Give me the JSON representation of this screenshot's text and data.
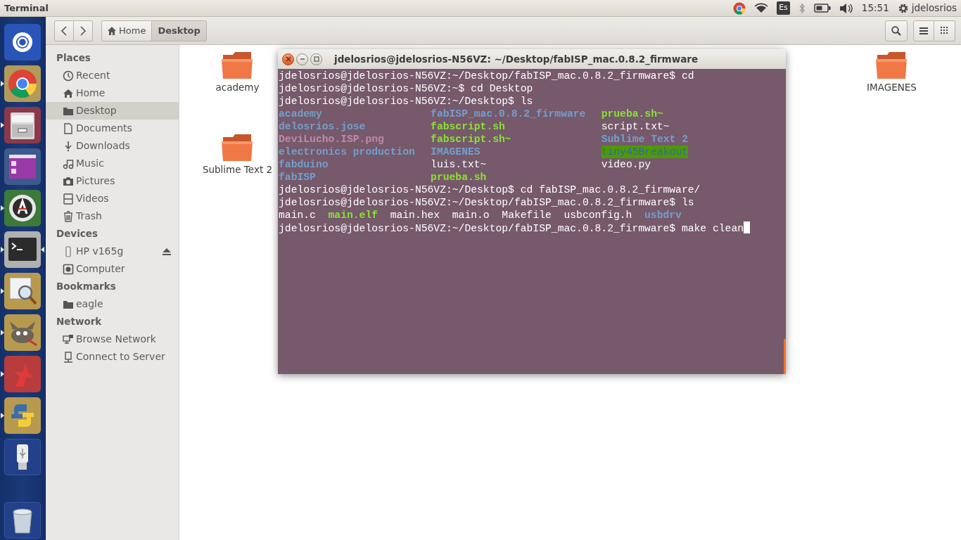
{
  "top_panel": {
    "title": "Terminal",
    "indicators": [
      {
        "kind": "browser"
      },
      {
        "kind": "wifi"
      },
      {
        "kind": "keyboard",
        "text": "Es"
      },
      {
        "kind": "bluetooth"
      },
      {
        "kind": "battery"
      },
      {
        "kind": "volume"
      },
      {
        "kind": "clock",
        "text": "15:51"
      },
      {
        "kind": "session",
        "text": "jdelosrios"
      }
    ]
  },
  "launcher": [
    {
      "kind": "dash",
      "running": false,
      "focused": false
    },
    {
      "kind": "browser",
      "running": true,
      "focused": false
    },
    {
      "kind": "files",
      "running": true,
      "focused": false
    },
    {
      "kind": "workspaces",
      "running": false,
      "focused": false
    },
    {
      "kind": "updater",
      "running": true,
      "focused": false
    },
    {
      "kind": "terminal",
      "running": true,
      "focused": true
    },
    {
      "kind": "viewer",
      "running": true,
      "focused": false
    },
    {
      "kind": "gimp",
      "running": true,
      "focused": false
    },
    {
      "kind": "cad",
      "running": true,
      "focused": false
    },
    {
      "kind": "python",
      "running": true,
      "focused": false
    },
    {
      "kind": "usb",
      "running": false,
      "focused": false
    },
    {
      "kind": "trash",
      "running": false,
      "focused": false
    }
  ],
  "toolbar": {
    "path": [
      {
        "label": "Home",
        "kind": "home",
        "selected": false
      },
      {
        "label": "Desktop",
        "kind": "plain",
        "selected": true
      }
    ]
  },
  "sidebar": {
    "sections": [
      {
        "title": "Places",
        "items": [
          {
            "label": "Recent",
            "kind": "recent",
            "selected": false
          },
          {
            "label": "Home",
            "kind": "home",
            "selected": false
          },
          {
            "label": "Desktop",
            "kind": "folder",
            "selected": true
          },
          {
            "label": "Documents",
            "kind": "document",
            "selected": false
          },
          {
            "label": "Downloads",
            "kind": "download",
            "selected": false
          },
          {
            "label": "Music",
            "kind": "music",
            "selected": false
          },
          {
            "label": "Pictures",
            "kind": "camera",
            "selected": false
          },
          {
            "label": "Videos",
            "kind": "video",
            "selected": false
          },
          {
            "label": "Trash",
            "kind": "trash",
            "selected": false
          }
        ]
      },
      {
        "title": "Devices",
        "items": [
          {
            "label": "HP v165g",
            "kind": "drive",
            "selected": false,
            "ejectable": true
          },
          {
            "label": "Computer",
            "kind": "computer",
            "selected": false
          }
        ]
      },
      {
        "title": "Bookmarks",
        "items": [
          {
            "label": "eagle",
            "kind": "folder",
            "selected": false
          }
        ]
      },
      {
        "title": "Network",
        "items": [
          {
            "label": "Browse Network",
            "kind": "network",
            "selected": false
          },
          {
            "label": "Connect to Server",
            "kind": "server",
            "selected": false
          }
        ]
      }
    ]
  },
  "file_rows": [
    [
      {
        "name": "academy",
        "kind": "folder"
      },
      {
        "name": "IMAGENES",
        "kind": "folder"
      }
    ],
    [
      {
        "name": "Sublime Text 2",
        "kind": "folder"
      }
    ]
  ],
  "terminal": {
    "title": "jdelosrios@jdelosrios-N56VZ: ~/Desktop/fabISP_mac.0.8.2_firmware",
    "lines": [
      {
        "kind": "text",
        "text": "jdelosrios@jdelosrios-N56VZ:~/Desktop/fabISP_mac.0.8.2_firmware$ cd"
      },
      {
        "kind": "text",
        "text": "jdelosrios@jdelosrios-N56VZ:~$ cd Desktop"
      },
      {
        "kind": "text",
        "text": "jdelosrios@jdelosrios-N56VZ:~/Desktop$ ls"
      },
      {
        "kind": "columns",
        "columns": [
          [
            {
              "name": "academy",
              "kind": "directory"
            },
            {
              "name": "delosrios.jose",
              "kind": "directory"
            },
            {
              "name": "DeviLucho.ISP.png",
              "kind": "image"
            },
            {
              "name": "electronics production",
              "kind": "directory"
            },
            {
              "name": "fabduino",
              "kind": "directory"
            },
            {
              "name": "fabISP",
              "kind": "directory"
            }
          ],
          [
            {
              "name": "fabISP_mac.0.8.2_firmware",
              "kind": "directory"
            },
            {
              "name": "fabscript.sh",
              "kind": "executable"
            },
            {
              "name": "fabscript.sh~",
              "kind": "executable"
            },
            {
              "name": "IMAGENES",
              "kind": "directory"
            },
            {
              "name": "luis.txt~",
              "kind": "file"
            },
            {
              "name": "prueba.sh",
              "kind": "executable"
            }
          ],
          [
            {
              "name": "prueba.sh~",
              "kind": "executable"
            },
            {
              "name": "script.txt~",
              "kind": "file"
            },
            {
              "name": "Sublime Text 2",
              "kind": "directory"
            },
            {
              "name": "tiny45Breakout",
              "kind": "other_writable"
            },
            {
              "name": "video.py",
              "kind": "file"
            }
          ]
        ]
      },
      {
        "kind": "text",
        "text": "jdelosrios@jdelosrios-N56VZ:~/Desktop$ cd fabISP_mac.0.8.2_firmware/"
      },
      {
        "kind": "text",
        "text": "jdelosrios@jdelosrios-N56VZ:~/Desktop/fabISP_mac.0.8.2_firmware$ ls"
      },
      {
        "kind": "row",
        "entries": [
          {
            "name": "main.c",
            "kind": "file"
          },
          {
            "name": "main.elf",
            "kind": "executable"
          },
          {
            "name": "main.hex",
            "kind": "file"
          },
          {
            "name": "main.o",
            "kind": "file"
          },
          {
            "name": "Makefile",
            "kind": "file"
          },
          {
            "name": "usbconfig.h",
            "kind": "file"
          },
          {
            "name": "usbdrv",
            "kind": "directory"
          }
        ]
      },
      {
        "kind": "text",
        "text": "jdelosrios@jdelosrios-N56VZ:~/Desktop/fabISP_mac.0.8.2_firmware$ make clean",
        "cursor": true
      }
    ]
  }
}
